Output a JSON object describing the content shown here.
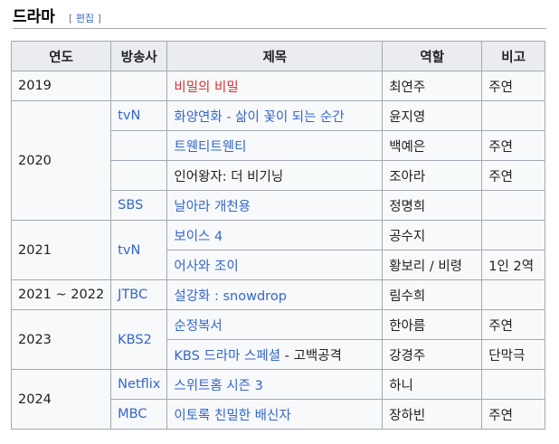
{
  "section": {
    "title": "드라마",
    "edit_open": "[",
    "edit_label": "편집",
    "edit_close": "]"
  },
  "table": {
    "headers": [
      "연도",
      "방송사",
      "제목",
      "역할",
      "비고"
    ],
    "year_2019": "2019",
    "year_2020": "2020",
    "year_2021": "2021",
    "year_2021_2022": "2021 ~ 2022",
    "year_2023": "2023",
    "year_2024": "2024",
    "broadcasters": {
      "tvn_2020": "tvN",
      "sbs": "SBS",
      "tvn_2021": "tvN",
      "jtbc": "JTBC",
      "kbs2": "KBS2",
      "netflix": "Netflix",
      "mbc": "MBC"
    },
    "rows": [
      {
        "title": "비밀의 비밀",
        "role": "최연주",
        "note": "주연"
      },
      {
        "title": "화양연화 - 삶이 꽃이 되는 순간",
        "role": "윤지영",
        "note": ""
      },
      {
        "title": "트웬티트웬티",
        "role": "백예은",
        "note": "주연"
      },
      {
        "title": "인어왕자: 더 비기닝",
        "role": "조아라",
        "note": "주연"
      },
      {
        "title": "날아라 개천용",
        "role": "정명희",
        "note": ""
      },
      {
        "title": "보이스 4",
        "role": "공수지",
        "note": ""
      },
      {
        "title": "어사와 조이",
        "role": "황보리 / 비령",
        "note": "1인 2역"
      },
      {
        "title": "설강화 : snowdrop",
        "role": "림수희",
        "note": ""
      },
      {
        "title": "순정복서",
        "role": "한아름",
        "note": "주연"
      },
      {
        "title_prefix": "KBS 드라마 스페셜",
        "title_sep": " - ",
        "title_suffix": "고백공격",
        "role": "강경주",
        "note": "단막극"
      },
      {
        "title": "스위트홈 시즌 3",
        "role": "하니",
        "note": ""
      },
      {
        "title": "이토록 친밀한 배신자",
        "role": "장하빈",
        "note": "주연"
      }
    ]
  },
  "colors": {
    "link": "#3366cc",
    "redlink": "#d73333",
    "header_bg": "#eaecf0",
    "cell_bg": "#f8f9fa",
    "border": "#a2a9b1"
  }
}
